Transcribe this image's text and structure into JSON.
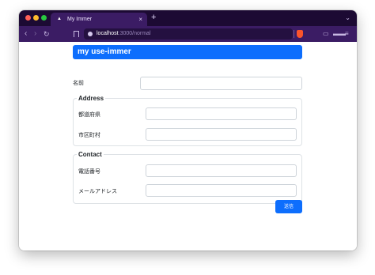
{
  "browser": {
    "tab_title": "My Immer",
    "tab_close": "×",
    "new_tab": "+",
    "url_host": "localhost",
    "url_path": ":3000/normal"
  },
  "page": {
    "header": "my use-immer",
    "name_label": "名前",
    "address": {
      "legend": "Address",
      "prefecture_label": "都道府県",
      "city_label": "市区町村"
    },
    "contact": {
      "legend": "Contact",
      "phone_label": "電話番号",
      "email_label": "メールアドレス"
    },
    "submit_label": "送信"
  },
  "colors": {
    "accent": "#0d6efd",
    "browser_chrome": "#3b1c64",
    "tab_strip": "#1c0a33"
  },
  "icons": [
    "back-icon",
    "forward-icon",
    "reload-icon",
    "bookmark-icon",
    "site-info-icon",
    "brave-shield-icon",
    "sidebar-icon",
    "wallet-icon",
    "menu-icon"
  ]
}
